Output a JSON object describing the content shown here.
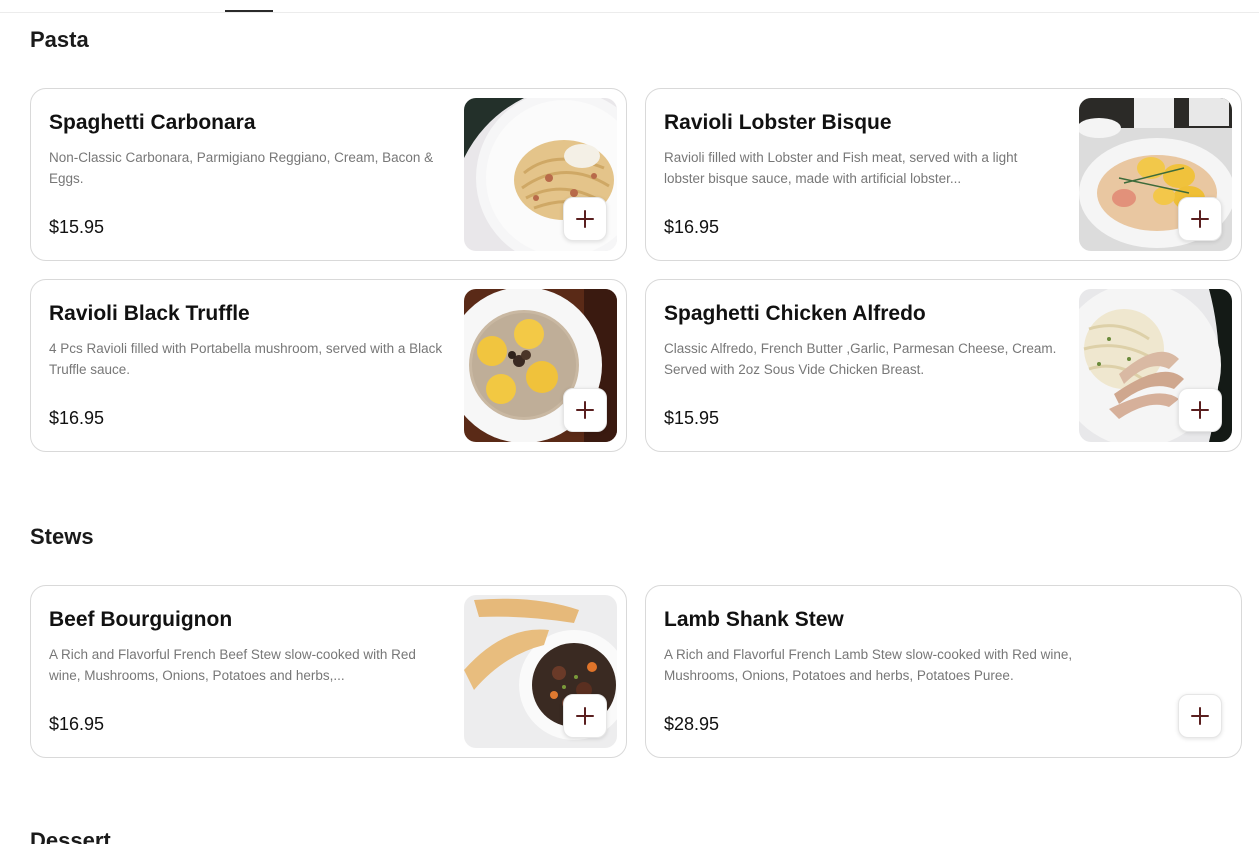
{
  "sections": {
    "pasta": {
      "title": "Pasta",
      "items": [
        {
          "name": "Spaghetti Carbonara",
          "description": "Non-Classic Carbonara, Parmigiano Reggiano, Cream, Bacon & Eggs.",
          "price": "$15.95",
          "image": "spaghetti-carbonara-photo"
        },
        {
          "name": "Ravioli Lobster Bisque",
          "description": "Ravioli filled with Lobster and Fish meat, served with a light lobster bisque sauce, made with artificial lobster...",
          "price": "$16.95",
          "image": "ravioli-lobster-bisque-photo"
        },
        {
          "name": "Ravioli Black Truffle",
          "description": "4 Pcs Ravioli filled with Portabella mushroom, served with a Black Truffle sauce.",
          "price": "$16.95",
          "image": "ravioli-black-truffle-photo"
        },
        {
          "name": "Spaghetti Chicken Alfredo",
          "description": "Classic Alfredo, French Butter ,Garlic, Parmesan Cheese, Cream. Served with 2oz Sous Vide Chicken Breast.",
          "price": "$15.95",
          "image": "spaghetti-chicken-alfredo-photo"
        }
      ]
    },
    "stews": {
      "title": "Stews",
      "items": [
        {
          "name": "Beef Bourguignon",
          "description": "A Rich and Flavorful French Beef Stew slow-cooked with Red wine, Mushrooms, Onions, Potatoes and herbs,...",
          "price": "$16.95",
          "image": "beef-bourguignon-photo"
        },
        {
          "name": "Lamb Shank Stew",
          "description": "A Rich and Flavorful French Lamb Stew slow-cooked with Red wine, Mushrooms, Onions, Potatoes and herbs, Potatoes Puree.",
          "price": "$28.95"
        }
      ]
    },
    "dessert": {
      "title": "Dessert"
    }
  },
  "colors": {
    "accent": "#5a1f1f",
    "border": "#d9d9d9",
    "description_text": "#777777"
  },
  "icons": {
    "add": "plus-icon"
  }
}
